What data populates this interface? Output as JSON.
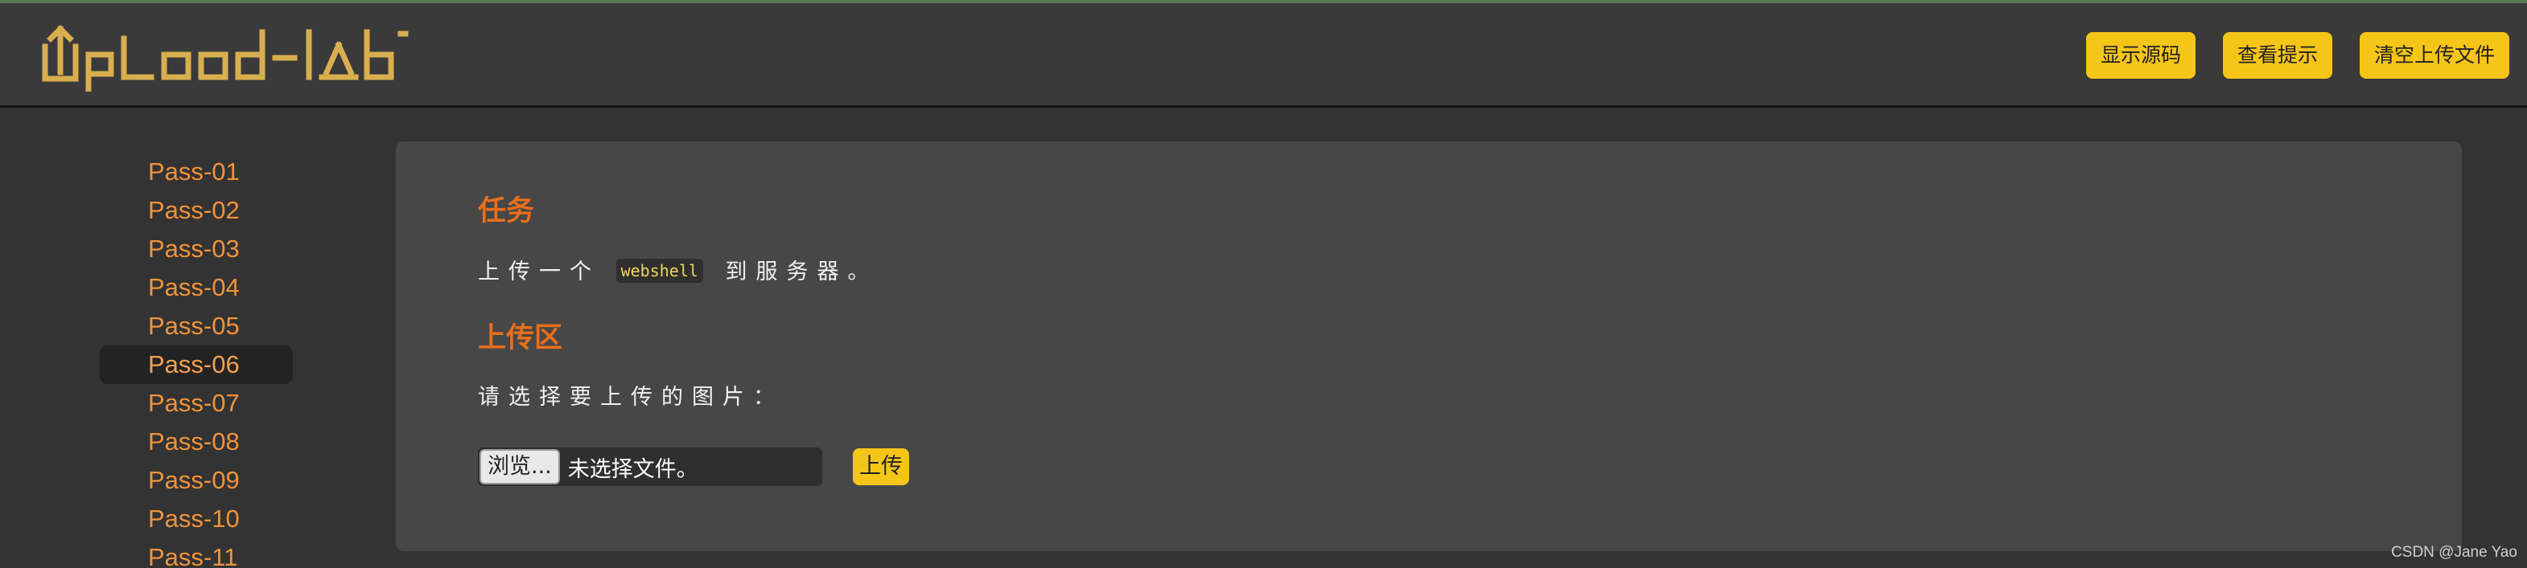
{
  "header": {
    "logo_text": "UpLoad-labS",
    "buttons": [
      "显示源码",
      "查看提示",
      "清空上传文件"
    ]
  },
  "sidebar": {
    "items": [
      {
        "label": "Pass-01"
      },
      {
        "label": "Pass-02"
      },
      {
        "label": "Pass-03"
      },
      {
        "label": "Pass-04"
      },
      {
        "label": "Pass-05"
      },
      {
        "label": "Pass-06"
      },
      {
        "label": "Pass-07"
      },
      {
        "label": "Pass-08"
      },
      {
        "label": "Pass-09"
      },
      {
        "label": "Pass-10"
      },
      {
        "label": "Pass-11"
      }
    ],
    "active_item": "Pass-06"
  },
  "task": {
    "title": "任务",
    "text_before": "上传一个",
    "code": "webshell",
    "text_after": "到服务器。"
  },
  "upload_area": {
    "title": "上传区",
    "prompt": "请选择要上传的图片：",
    "browse_label": "浏览...",
    "no_file_text": "未选择文件。",
    "submit_label": "上传"
  },
  "footer": {
    "watermark": "CSDN @Jane Yao"
  },
  "colors": {
    "accent": "#f5c518",
    "heading": "#e86e1c",
    "link": "#f0933a",
    "logo": "#d9ae4f",
    "background": "#333333",
    "panel": "#474747"
  }
}
